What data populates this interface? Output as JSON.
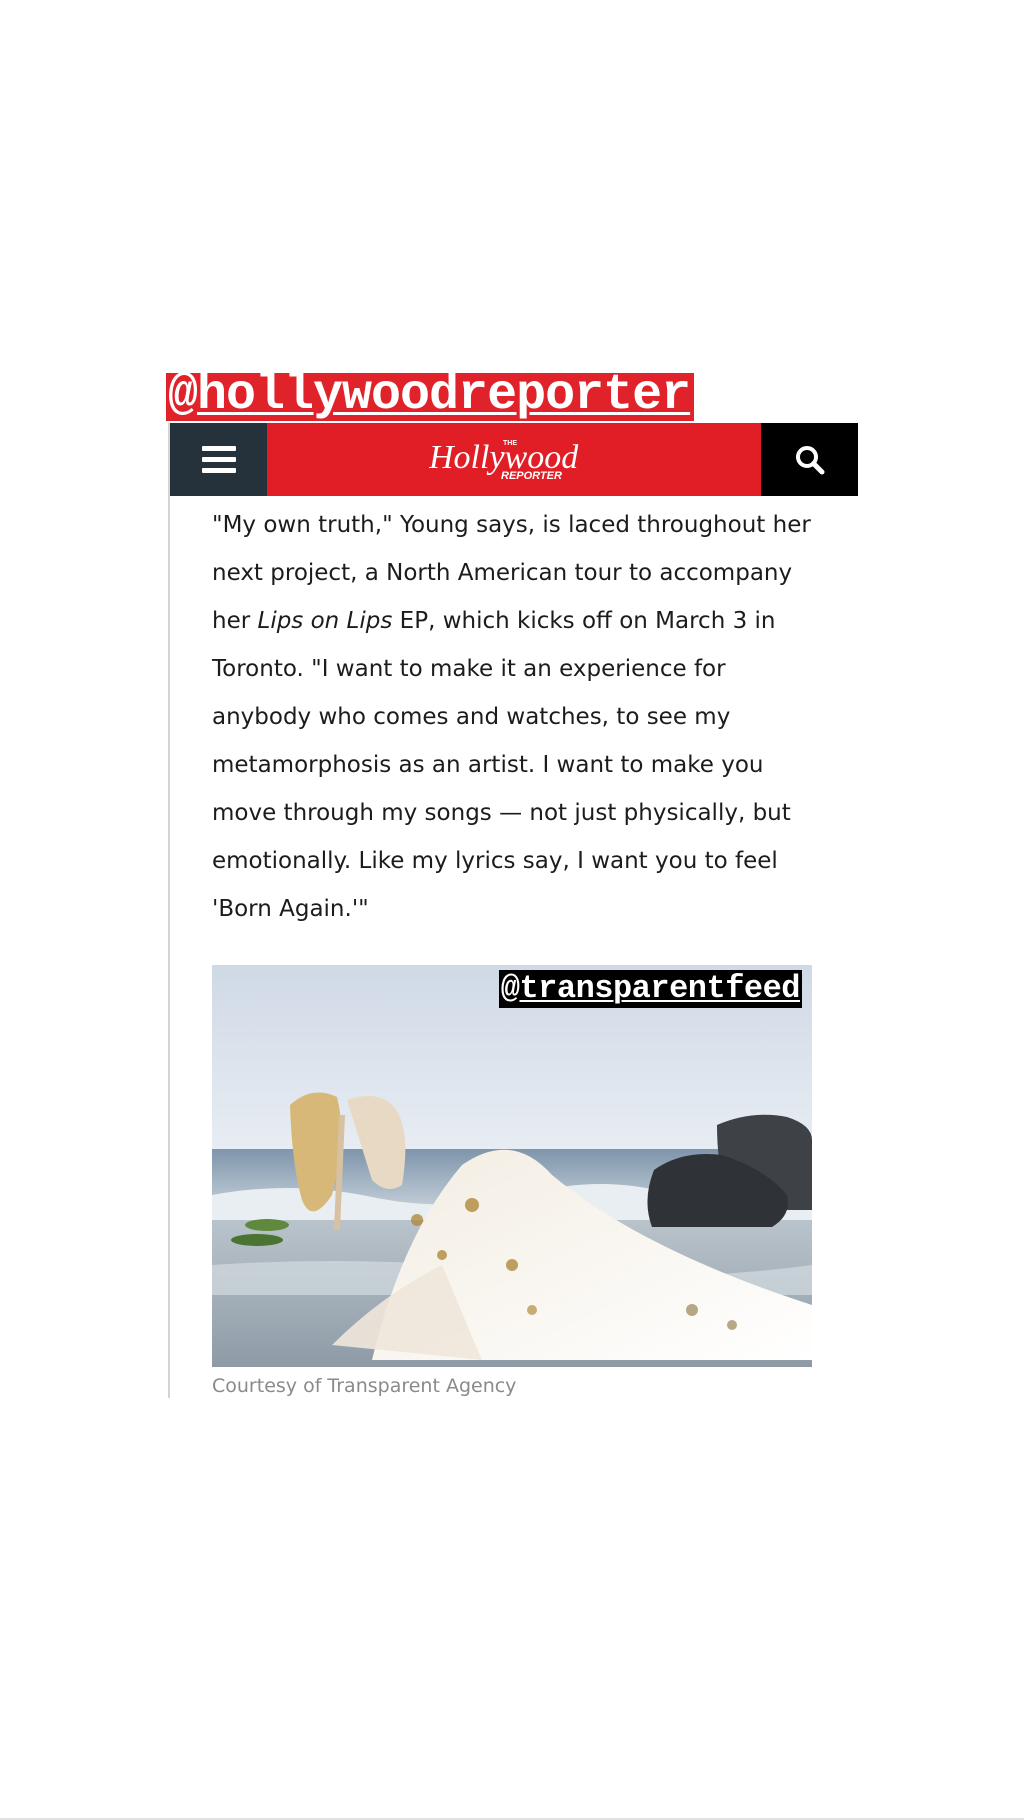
{
  "stickers": {
    "top_handle_at": "@",
    "top_handle_name": "hollywoodreporter",
    "photo_handle_at": "@",
    "photo_handle_name": "transparentfeed"
  },
  "header": {
    "menu_icon": "hamburger-menu-icon",
    "logo_main": "Hollywood",
    "logo_small_top": "THE",
    "logo_small_bottom": "REPORTER",
    "search_icon": "search-icon"
  },
  "article": {
    "p1_a": "\"My own truth,\" Young says, is laced throughout her next project, a North American tour to accompany her ",
    "p1_em": "Lips on Lips",
    "p1_b": " EP, which kicks off on March 3 in Toronto. \"I want to make it an experience for anybody who comes and watches, to see my metamorphosis as an artist. I want to make you move through my songs — not just physically, but emotionally. Like my lyrics say, I want you to feel 'Born Again.'\""
  },
  "figure": {
    "caption": "Courtesy of Transparent Agency"
  },
  "colors": {
    "brand_red": "#e11e26",
    "menu_dark": "#25313b",
    "search_black": "#000000",
    "caption_gray": "#8a8a8a"
  }
}
